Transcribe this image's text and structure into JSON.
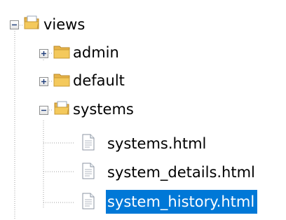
{
  "tree": {
    "root": {
      "label": "views",
      "expanded": true,
      "icon": "folder-open-icon",
      "children": [
        {
          "label": "admin",
          "expanded": false,
          "icon": "folder-icon"
        },
        {
          "label": "default",
          "expanded": false,
          "icon": "folder-icon"
        },
        {
          "label": "systems",
          "expanded": true,
          "icon": "folder-open-icon",
          "children": [
            {
              "label": "systems.html",
              "icon": "file-icon",
              "selected": false
            },
            {
              "label": "system_details.html",
              "icon": "file-icon",
              "selected": false
            },
            {
              "label": "system_history.html",
              "icon": "file-icon",
              "selected": true
            }
          ]
        }
      ]
    }
  },
  "colors": {
    "selection": "#0078d7",
    "folder": "#f4c95c",
    "guide": "#a0a0a0"
  }
}
